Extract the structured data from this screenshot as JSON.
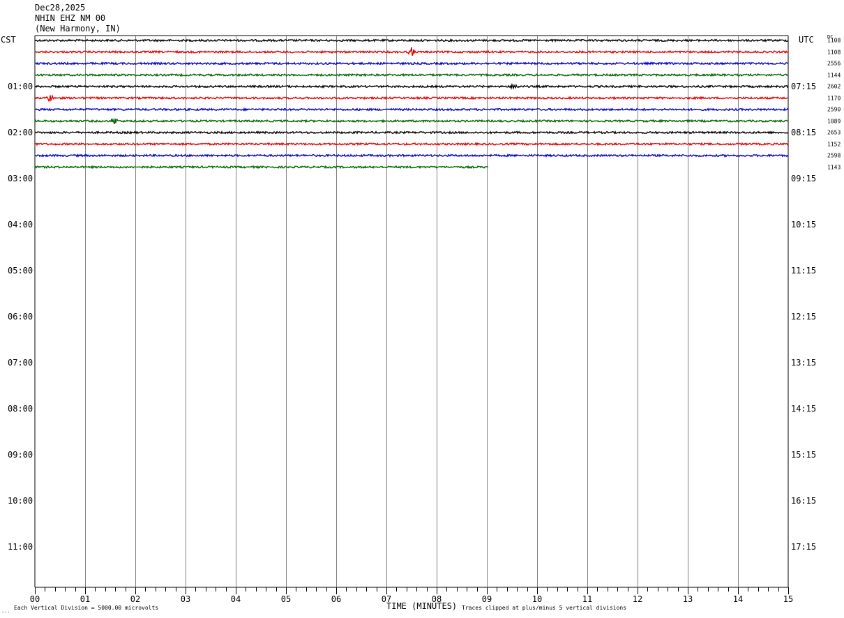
{
  "header": {
    "date": "Dec28,2025",
    "station": "NHIN EHZ NM 00",
    "location": "(New Harmony, IN)"
  },
  "left_tz": "CST",
  "right_tz": "UTC",
  "dc_label": "DC",
  "footer": {
    "left_note": "Each Vertical Division = 5000.00 microvolts",
    "right_note": "Traces clipped at plus/minus 5 vertical divisions",
    "corner_mark": "..."
  },
  "chart_data": {
    "type": "line",
    "title": "NHIN EHZ NM 00",
    "xlabel": "TIME (MINUTES)",
    "xlim": [
      0,
      15
    ],
    "x_ticks": [
      "00",
      "01",
      "02",
      "03",
      "04",
      "05",
      "06",
      "07",
      "08",
      "09",
      "10",
      "11",
      "12",
      "13",
      "14",
      "15"
    ],
    "hour_rows": [
      {
        "local": "01:00",
        "utc": "07:15"
      },
      {
        "local": "02:00",
        "utc": "08:15"
      },
      {
        "local": "03:00",
        "utc": "09:15"
      },
      {
        "local": "04:00",
        "utc": "10:15"
      },
      {
        "local": "05:00",
        "utc": "11:15"
      },
      {
        "local": "06:00",
        "utc": "12:15"
      },
      {
        "local": "07:00",
        "utc": "13:15"
      },
      {
        "local": "08:00",
        "utc": "14:15"
      },
      {
        "local": "09:00",
        "utc": "15:15"
      },
      {
        "local": "10:00",
        "utc": "16:15"
      },
      {
        "local": "11:00",
        "utc": "17:15"
      }
    ],
    "rows_per_hour": 4,
    "total_rows": 48,
    "traces": [
      {
        "row": 0,
        "color": "#000000",
        "dc": "1108",
        "end_min": 15,
        "events": []
      },
      {
        "row": 1,
        "color": "#e00000",
        "dc": "1108",
        "end_min": 15,
        "events": [
          7.5
        ]
      },
      {
        "row": 2,
        "color": "#0000cc",
        "dc": "2556",
        "end_min": 15,
        "events": []
      },
      {
        "row": 3,
        "color": "#006400",
        "dc": "1144",
        "end_min": 15,
        "events": []
      },
      {
        "row": 4,
        "color": "#000000",
        "dc": "2602",
        "end_min": 15,
        "events": [
          9.55
        ]
      },
      {
        "row": 5,
        "color": "#e00000",
        "dc": "1170",
        "end_min": 15,
        "events": [
          0.3
        ]
      },
      {
        "row": 6,
        "color": "#0000cc",
        "dc": "2590",
        "end_min": 15,
        "events": []
      },
      {
        "row": 7,
        "color": "#006400",
        "dc": "1089",
        "end_min": 15,
        "events": [
          1.58
        ]
      },
      {
        "row": 8,
        "color": "#000000",
        "dc": "2653",
        "end_min": 15,
        "events": []
      },
      {
        "row": 9,
        "color": "#e00000",
        "dc": "1152",
        "end_min": 15,
        "events": []
      },
      {
        "row": 10,
        "color": "#0000cc",
        "dc": "2598",
        "end_min": 15,
        "events": []
      },
      {
        "row": 11,
        "color": "#006400",
        "dc": "1143",
        "end_min": 9.03,
        "events": []
      }
    ]
  }
}
